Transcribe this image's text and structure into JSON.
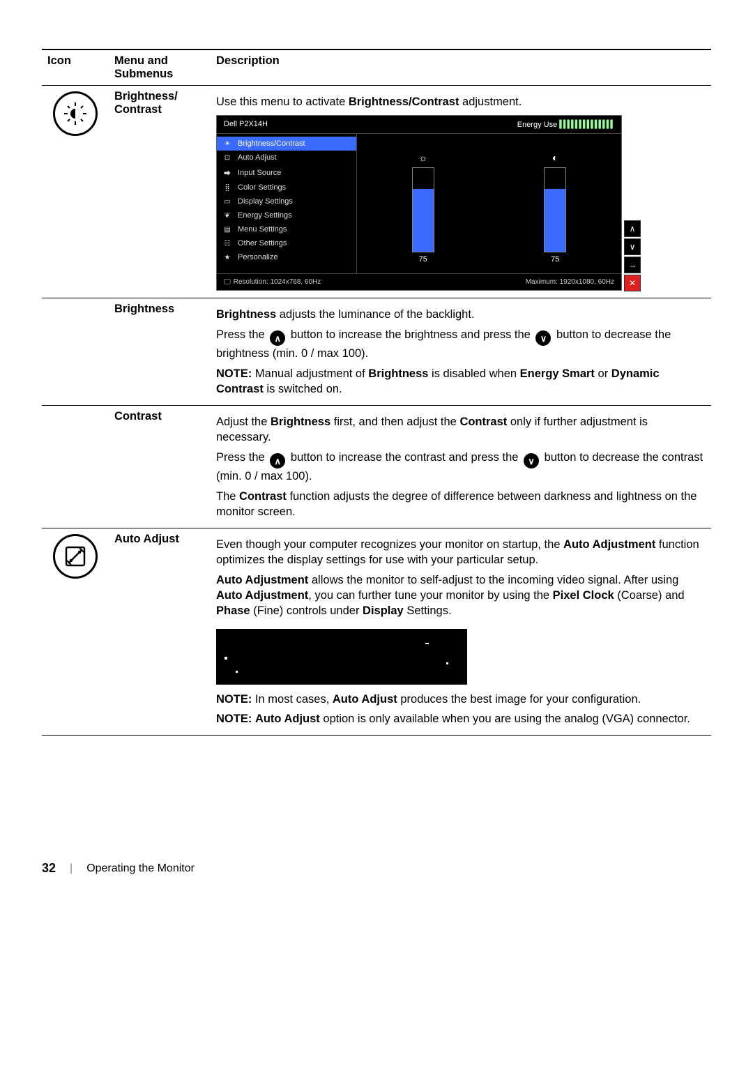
{
  "columns": {
    "icon": "Icon",
    "menu": "Menu and Submenus",
    "description": "Description"
  },
  "rows": {
    "brightness_contrast": {
      "menu": "Brightness/ Contrast",
      "intro_before": "Use this menu to activate ",
      "intro_bold": "Brightness/Contrast",
      "intro_after": " adjustment."
    },
    "brightness_sub": {
      "menu": "Brightness",
      "line1_bold": "Brightness",
      "line1_rest": " adjusts the luminance of the backlight.",
      "line2_a": "Press the ",
      "line2_b": " button to increase the brightness and press the ",
      "line2_c": " button to decrease the brightness (min. 0 / max 100).",
      "note_label": "NOTE:",
      "note_a": " Manual adjustment of ",
      "note_b1": "Brightness",
      "note_mid": " is disabled when ",
      "note_b2": "Energy Smart",
      "note_or": " or ",
      "note_b3": "Dynamic Contrast",
      "note_end": " is switched on."
    },
    "contrast_sub": {
      "menu": "Contrast",
      "line1_a": "Adjust the ",
      "line1_b1": "Brightness",
      "line1_mid": " first, and then adjust the ",
      "line1_b2": "Contrast",
      "line1_end": " only if further adjustment is necessary.",
      "line2_a": "Press the ",
      "line2_b": " button to increase the contrast and press the ",
      "line2_c": " button to decrease the contrast (min. 0 / max 100).",
      "line3_a": "The ",
      "line3_b": "Contrast",
      "line3_c": " function adjusts the degree of difference between darkness and lightness on the monitor screen."
    },
    "auto_adjust": {
      "menu": "Auto Adjust",
      "p1_a": "Even though your computer recognizes your monitor on startup, the ",
      "p1_b": "Auto Adjustment",
      "p1_c": " function optimizes the display settings for use with your particular setup.",
      "p2_a": "Auto Adjustment",
      "p2_b": " allows the monitor to self-adjust to the incoming video signal. After using ",
      "p2_c": "Auto Adjustment",
      "p2_d": ", you can further tune your monitor by using the ",
      "p2_e": "Pixel Clock",
      "p2_f": " (Coarse) and ",
      "p2_g": "Phase",
      "p2_h": " (Fine) controls under ",
      "p2_i": "Display",
      "p2_j": " Settings.",
      "note1_label": "NOTE:",
      "note1_a": " In most cases, ",
      "note1_b": "Auto Adjust",
      "note1_c": " produces the best image for your configuration.",
      "note2_label": "NOTE:",
      "note2_a": " ",
      "note2_b": "Auto Adjust",
      "note2_c": " option is only available when you are using the analog (VGA) connector."
    }
  },
  "osd": {
    "model": "Dell P2X14H",
    "energy_label": "Energy Use",
    "menu_items": [
      "Brightness/Contrast",
      "Auto Adjust",
      "Input Source",
      "Color Settings",
      "Display Settings",
      "Energy Settings",
      "Menu Settings",
      "Other Settings",
      "Personalize"
    ],
    "brightness_value": "75",
    "contrast_value": "75",
    "resolution": "Resolution: 1024x768, 60Hz",
    "maximum": "Maximum: 1920x1080, 60Hz"
  },
  "footer": {
    "page": "32",
    "section": "Operating the Monitor"
  }
}
